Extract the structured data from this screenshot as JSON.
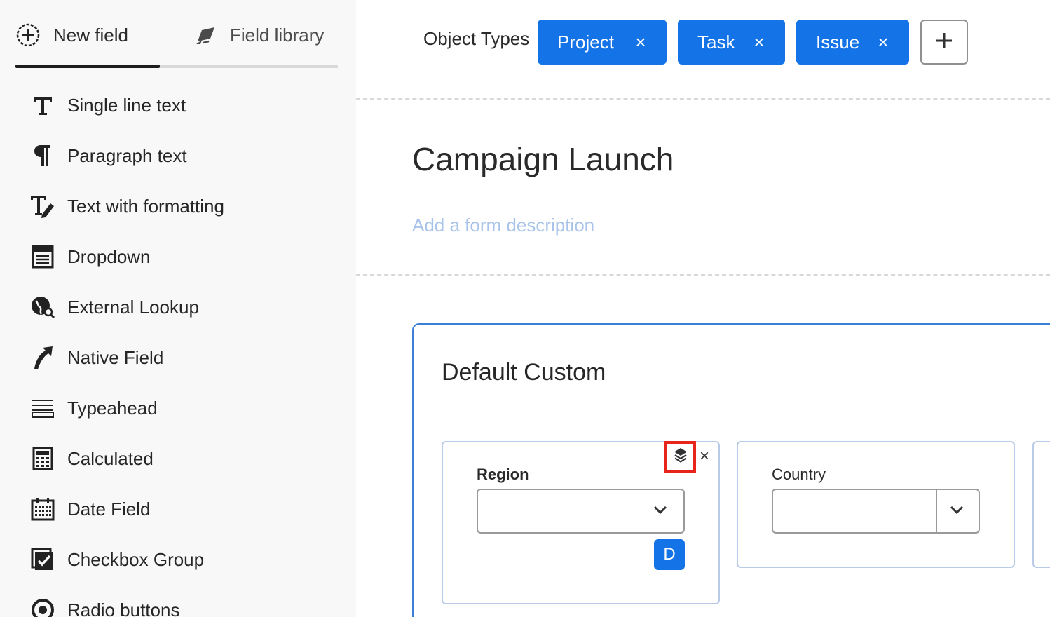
{
  "sidebar": {
    "tabs": [
      {
        "label": "New field",
        "icon": "add-circle-icon",
        "selected": true
      },
      {
        "label": "Field library",
        "icon": "field-library-icon",
        "selected": false
      }
    ],
    "fields": [
      {
        "label": "Single line text",
        "icon": "text-icon"
      },
      {
        "label": "Paragraph text",
        "icon": "paragraph-icon"
      },
      {
        "label": "Text with formatting",
        "icon": "text-formatting-icon"
      },
      {
        "label": "Dropdown",
        "icon": "dropdown-icon"
      },
      {
        "label": "External Lookup",
        "icon": "globe-search-icon"
      },
      {
        "label": "Native Field",
        "icon": "native-field-icon"
      },
      {
        "label": "Typeahead",
        "icon": "typeahead-icon"
      },
      {
        "label": "Calculated",
        "icon": "calculator-icon"
      },
      {
        "label": "Date Field",
        "icon": "calendar-icon"
      },
      {
        "label": "Checkbox Group",
        "icon": "checkbox-icon"
      },
      {
        "label": "Radio buttons",
        "icon": "radio-icon"
      }
    ]
  },
  "object_types": {
    "label": "Object Types",
    "chips": [
      {
        "label": "Project",
        "remove": "×"
      },
      {
        "label": "Task",
        "remove": "×"
      },
      {
        "label": "Issue",
        "remove": "×"
      }
    ],
    "add_label": "+"
  },
  "form": {
    "title": "Campaign Launch",
    "description_placeholder": "Add a form description",
    "section": {
      "title": "Default Custom",
      "fields": [
        {
          "label": "Region",
          "value": "",
          "badge": "D",
          "close": "×"
        },
        {
          "label": "Country",
          "value": ""
        }
      ]
    }
  },
  "colors": {
    "accent": "#1473e6",
    "highlight": "#e8251a",
    "section_border": "#3b7fd6",
    "placeholder": "#a9c4ea"
  }
}
